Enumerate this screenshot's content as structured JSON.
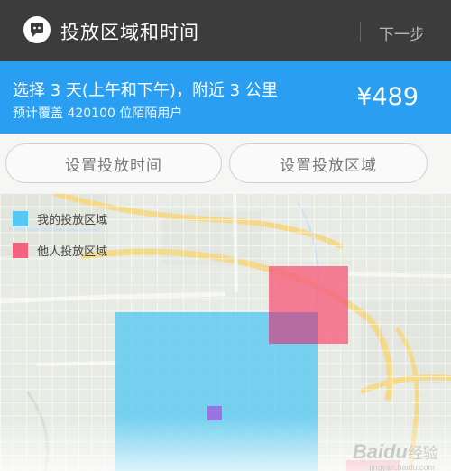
{
  "header": {
    "title": "投放区域和时间",
    "next_label": "下一步"
  },
  "banner": {
    "summary": "选择 3 天(上午和下午)，附近 3 公里",
    "coverage": "预计覆盖 420100 位陌陌用户",
    "price": "¥489"
  },
  "buttons": {
    "set_time": "设置投放时间",
    "set_area": "设置投放区域"
  },
  "legend": [
    {
      "label": "我的投放区域",
      "color": "#54c8f4"
    },
    {
      "label": "他人投放区域",
      "color": "#f56280"
    }
  ],
  "watermark": {
    "brand": "Baidu",
    "suffix": "经验",
    "url": "jingyan.baidu.com"
  }
}
